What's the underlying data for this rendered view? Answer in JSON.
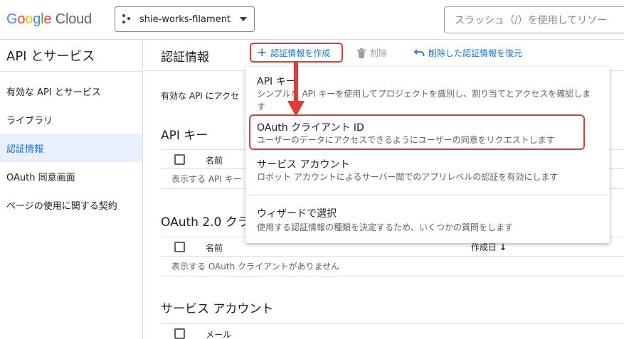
{
  "topbar": {
    "logo": {
      "google": "Google",
      "cloud": "Cloud",
      "google_colors": [
        "#4285F4",
        "#EA4335",
        "#FBBC05",
        "#4285F4",
        "#34A853",
        "#EA4335"
      ]
    },
    "project": {
      "name": "shie-works-filament",
      "icon": "project-dots-icon"
    },
    "search": {
      "placeholder": "スラッシュ（/）を使用してリソー"
    }
  },
  "sidebar": {
    "title": "API とサービス",
    "items": [
      {
        "label": "有効な API とサービス",
        "active": false
      },
      {
        "label": "ライブラリ",
        "active": false
      },
      {
        "label": "認証情報",
        "active": true
      },
      {
        "label": "OAuth 同意画面",
        "active": false
      },
      {
        "label": "ページの使用に関する契約",
        "active": false
      }
    ]
  },
  "header": {
    "title": "認証情報",
    "create_label": "認証情報を作成",
    "delete_label": "削除",
    "restore_label": "削除した認証情報を復元"
  },
  "content": {
    "intro": "有効な API にアクセ",
    "api_keys": {
      "title": "API キー",
      "col_name": "名前",
      "empty": "表示する API キー"
    },
    "oauth": {
      "title": "OAuth 2.0 クラ",
      "col_name": "名前",
      "col_created": "作成日",
      "empty": "表示する OAuth クライアントがありません"
    },
    "service_accounts": {
      "title": "サービス アカウント",
      "col_email": "メール"
    }
  },
  "menu": {
    "items": [
      {
        "title": "API キー",
        "desc": "シンプルな API キーを使用してプロジェクトを識別し、割り当てとアクセスを確認します"
      },
      {
        "title": "OAuth クライアント ID",
        "desc": "ユーザーのデータにアクセスできるようにユーザーの同意をリクエストします"
      },
      {
        "title": "サービス アカウント",
        "desc": "ロボット アカウントによるサーバー間でのアプリレベルの認証を有効にします"
      },
      {
        "title": "ウィザードで選択",
        "desc": "使用する認証情報の種類を決定するため、いくつかの質問をします"
      }
    ]
  },
  "colors": {
    "accent": "#1a73e8",
    "annotation": "#e53935",
    "active_nav_bg": "#e8f0fe"
  }
}
